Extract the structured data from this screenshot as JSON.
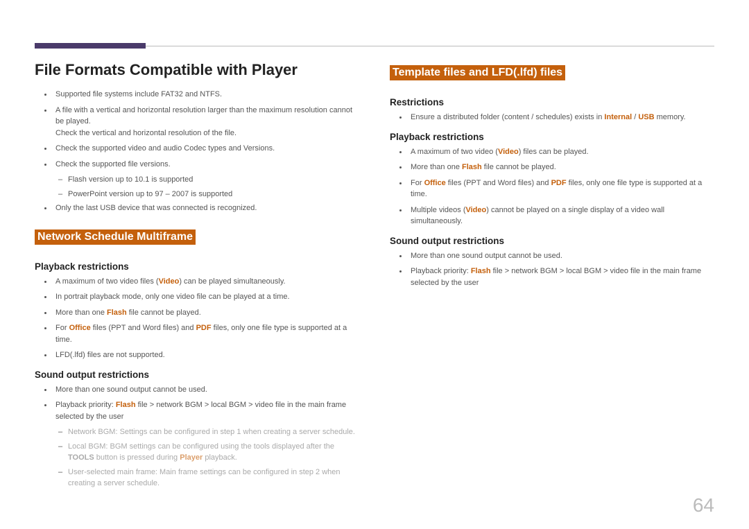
{
  "page_number": "64",
  "left": {
    "h1": "File Formats Compatible with Player",
    "b1": "Supported file systems include FAT32 and NTFS.",
    "b2a": "A file with a vertical and horizontal resolution larger than the maximum resolution cannot be played.",
    "b2b": "Check the vertical and horizontal resolution of the file.",
    "b3": "Check the supported video and audio Codec types and Versions.",
    "b4": "Check the supported file versions.",
    "b4d1": "Flash version up to 10.1 is supported",
    "b4d2": "PowerPoint version up to 97 – 2007 is supported",
    "b5": "Only the last USB device that was connected is recognized.",
    "h2": "Network Schedule Multiframe",
    "h3a": "Playback restrictions",
    "pr1_a": "A maximum of two video files (",
    "pr1_b": "Video",
    "pr1_c": ") can be played simultaneously.",
    "pr2": "In portrait playback mode, only one video file can be played at a time.",
    "pr3_a": "More than one ",
    "pr3_b": "Flash",
    "pr3_c": " file cannot be played.",
    "pr4_a": "For ",
    "pr4_b": "Office",
    "pr4_c": " files (PPT and Word files) and ",
    "pr4_d": "PDF",
    "pr4_e": " files, only one file type is supported at a time.",
    "pr5": "LFD(.lfd) files are not supported.",
    "h3b": "Sound output restrictions",
    "so1": "More than one sound output cannot be used.",
    "so2_a": "Playback priority: ",
    "so2_b": "Flash",
    "so2_c": " file > network BGM > local BGM > video file in the main frame selected by the user",
    "sod1": "Network BGM: Settings can be configured in step 1 when creating a server schedule.",
    "sod2_a": "Local BGM: BGM settings can be configured using the tools displayed after the ",
    "sod2_b": "TOOLS",
    "sod2_c": " button is pressed during ",
    "sod2_d": "Player",
    "sod2_e": " playback.",
    "sod3": "User-selected main frame: Main frame settings can be configured in step 2 when creating a server schedule."
  },
  "right": {
    "h2": "Template files and LFD(.lfd) files",
    "h3a": "Restrictions",
    "r1_a": "Ensure a distributed folder (content / schedules) exists in ",
    "r1_b": "Internal",
    "r1_c": " / ",
    "r1_d": "USB",
    "r1_e": " memory.",
    "h3b": "Playback restrictions",
    "pb1_a": "A maximum of two video (",
    "pb1_b": "Video",
    "pb1_c": ") files can be played.",
    "pb2_a": "More than one ",
    "pb2_b": "Flash",
    "pb2_c": " file cannot be played.",
    "pb3_a": "For ",
    "pb3_b": "Office",
    "pb3_c": " files (PPT and Word files) and ",
    "pb3_d": "PDF",
    "pb3_e": " files, only one file type is supported at a time.",
    "pb4_a": "Multiple videos (",
    "pb4_b": "Video",
    "pb4_c": ") cannot be played on a single display of a video wall simultaneously.",
    "h3c": "Sound output restrictions",
    "so1": "More than one sound output cannot be used.",
    "so2_a": "Playback priority: ",
    "so2_b": "Flash",
    "so2_c": " file > network BGM > local BGM > video file in the main frame selected by the user"
  }
}
